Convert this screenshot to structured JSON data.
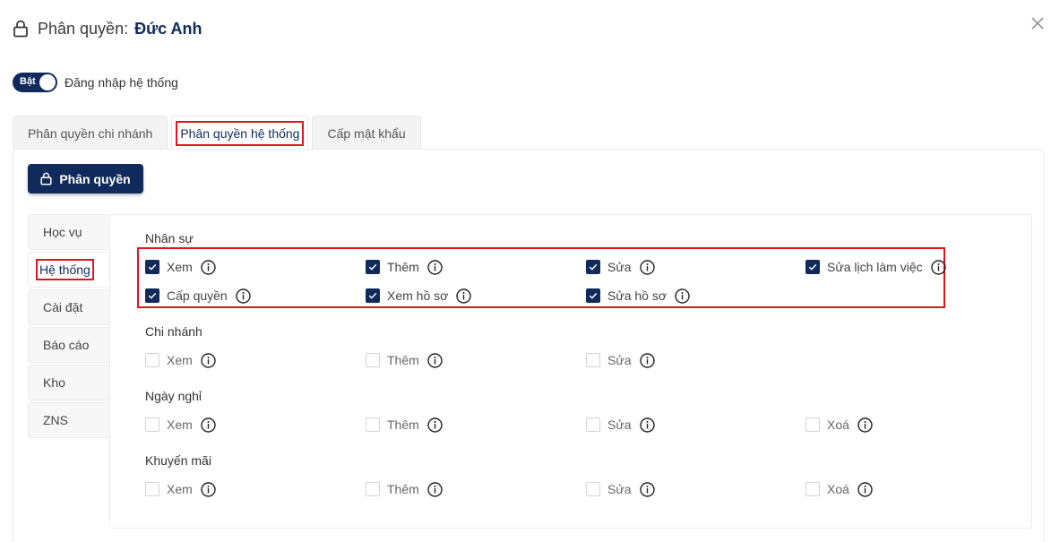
{
  "header": {
    "title_prefix": "Phân quyền:",
    "title_name": "Đức Anh",
    "lock_icon": "lock-icon",
    "close_icon": "close-icon"
  },
  "login_toggle": {
    "state_label": "Bật",
    "label": "Đăng nhập hệ thống",
    "enabled": true
  },
  "tabs": [
    {
      "label": "Phân quyền chi nhánh",
      "active": false
    },
    {
      "label": "Phân quyền hệ thống",
      "active": true
    },
    {
      "label": "Cấp mật khẩu",
      "active": false
    }
  ],
  "permission_button": {
    "label": "Phân quyền",
    "icon": "lock-icon"
  },
  "side_nav": [
    {
      "label": "Học vụ",
      "active": false
    },
    {
      "label": "Hệ thống",
      "active": true
    },
    {
      "label": "Cài đặt",
      "active": false
    },
    {
      "label": "Báo cáo",
      "active": false
    },
    {
      "label": "Kho",
      "active": false
    },
    {
      "label": "ZNS",
      "active": false
    }
  ],
  "groups": [
    {
      "title": "Nhân sự",
      "permissions": [
        {
          "label": "Xem",
          "checked": true
        },
        {
          "label": "Thêm",
          "checked": true
        },
        {
          "label": "Sửa",
          "checked": true
        },
        {
          "label": "Sửa lịch làm việc",
          "checked": true
        },
        {
          "label": "Cấp quyền",
          "checked": true
        },
        {
          "label": "Xem hồ sơ",
          "checked": true
        },
        {
          "label": "Sửa hồ sơ",
          "checked": true
        }
      ]
    },
    {
      "title": "Chi nhánh",
      "permissions": [
        {
          "label": "Xem",
          "checked": false
        },
        {
          "label": "Thêm",
          "checked": false
        },
        {
          "label": "Sửa",
          "checked": false
        }
      ]
    },
    {
      "title": "Ngày nghỉ",
      "permissions": [
        {
          "label": "Xem",
          "checked": false
        },
        {
          "label": "Thêm",
          "checked": false
        },
        {
          "label": "Sửa",
          "checked": false
        },
        {
          "label": "Xoá",
          "checked": false
        }
      ]
    },
    {
      "title": "Khuyến mãi",
      "permissions": [
        {
          "label": "Xem",
          "checked": false
        },
        {
          "label": "Thêm",
          "checked": false
        },
        {
          "label": "Sửa",
          "checked": false
        },
        {
          "label": "Xoá",
          "checked": false
        }
      ]
    }
  ],
  "colors": {
    "primary": "#0f2a5b",
    "highlight": "#e0141c",
    "border": "#ececec"
  }
}
